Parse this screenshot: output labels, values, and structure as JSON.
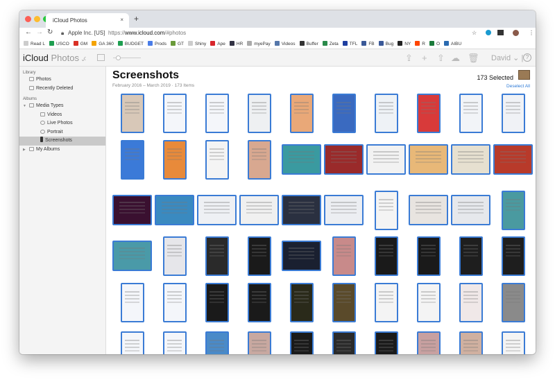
{
  "browser": {
    "tab_title": "iCloud Photos",
    "site_identity": "Apple Inc. [US]",
    "url_prefix": "https://",
    "url_host": "www.icloud.com",
    "url_path": "/#photos",
    "bookmarks": [
      {
        "label": "Read L",
        "color": "#ccc"
      },
      {
        "label": "USCO",
        "color": "#1e9e50"
      },
      {
        "label": "GM",
        "color": "#d93025"
      },
      {
        "label": "GA 360",
        "color": "#f4a300"
      },
      {
        "label": "BUDGET",
        "color": "#1e9e50"
      },
      {
        "label": "Prods",
        "color": "#4a7de8"
      },
      {
        "label": "GT",
        "color": "#6a9a3a"
      },
      {
        "label": "Shiny",
        "color": "#ccc"
      },
      {
        "label": "Ape",
        "color": "#d8262c"
      },
      {
        "label": "HR",
        "color": "#334"
      },
      {
        "label": "myePay",
        "color": "#aaa"
      },
      {
        "label": "Videos",
        "color": "#5577aa"
      },
      {
        "label": "Buffer",
        "color": "#333"
      },
      {
        "label": "Zeta",
        "color": "#2a8a4a"
      },
      {
        "label": "TFL",
        "color": "#1f3fa0"
      },
      {
        "label": "FB",
        "color": "#3b5998"
      },
      {
        "label": "Bug",
        "color": "#3b5998"
      },
      {
        "label": "NY",
        "color": "#222"
      },
      {
        "label": "R",
        "color": "#ff4500"
      },
      {
        "label": "O",
        "color": "#1a7a3a"
      },
      {
        "label": "AIBU",
        "color": "#2a6ab0"
      }
    ]
  },
  "app": {
    "brand": "iCloud",
    "section": "Photos",
    "user": "David"
  },
  "sidebar": {
    "library_header": "Library",
    "library": [
      {
        "label": "Photos"
      },
      {
        "label": "Recently Deleted"
      }
    ],
    "albums_header": "Albums",
    "media_types": "Media Types",
    "media": [
      {
        "label": "Videos"
      },
      {
        "label": "Live Photos"
      },
      {
        "label": "Portrait"
      },
      {
        "label": "Screenshots",
        "selected": true
      }
    ],
    "my_albums": "My Albums"
  },
  "main": {
    "title": "Screenshots",
    "date_range": "February 2016 – March 2019",
    "count": "173 Items",
    "selected": "173 Selected",
    "deselect": "Deselect All"
  },
  "thumbnails": [
    [
      "p:#d8c8b8",
      "p:#f4f6fa",
      "p:#f4f6fa",
      "p:#eef0f2",
      "p:#e9a878",
      "p:#3a6ac0",
      "p:#eef2f6",
      "p:#d83a3a",
      "p:#f2f4f8",
      "p:#f0f2f6"
    ],
    [
      "p:#3b7ad8",
      "p:#e88a3a",
      "p:#f4f4f4",
      "p:#d8a890",
      "l:#3a9aa0",
      "l:#9a2a2a",
      "l:#f2f2f2",
      "l:#e8b878",
      "l:#e6e0d0",
      "l:#b83a2a"
    ],
    [
      "l:#3a1030",
      "l:#3a8ac0",
      "l:#eef0f4",
      "l:#f0f0f0",
      "l:#2a3040",
      "l:#eceef2",
      "p:#f4f4f4",
      "l:#e8e4e0",
      "l:#e6e8ec",
      "p:#4a9aa0"
    ],
    [
      "l:#4a9aa8",
      "p:#e6e6ea",
      "p:#2a2a2a",
      "p:#1a1a1a",
      "l:#1a2030",
      "p:#c88a8a",
      "p:#1a1a1a",
      "p:#1a1a1a",
      "p:#1e1e1e",
      "p:#1e1e1e"
    ],
    [
      "p:#f4f6fa",
      "p:#f4f6fa",
      "p:#1a1a1a",
      "p:#1a1a1a",
      "p:#2a2a1a",
      "p:#5a4a2a",
      "p:#f4f4f4",
      "p:#f4f4f4",
      "p:#f0e8e8",
      "p:#8a8a8a"
    ],
    [
      "p:#f4f6fa",
      "p:#f4f6fa",
      "p:#4a8ac8",
      "p:#c8a8a0",
      "p:#1a1a1a",
      "p:#2a2a2a",
      "p:#1a1a1a",
      "p:#c8a0a0",
      "p:#d0b0a0",
      "p:#f4f4f4"
    ]
  ]
}
